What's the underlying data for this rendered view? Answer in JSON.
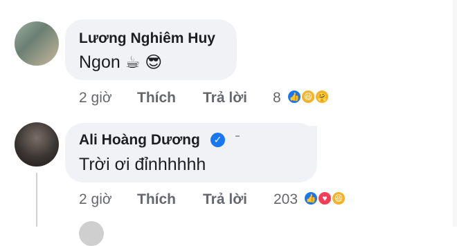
{
  "comments": [
    {
      "author": "Lương Nghiêm Huy",
      "text": "Ngon",
      "time": "2 giờ",
      "like_label": "Thích",
      "reply_label": "Trả lời",
      "reaction_count": "8",
      "reactions": [
        "like",
        "haha",
        "care"
      ],
      "verified": false
    },
    {
      "author": "Ali Hoàng Dương",
      "text": "Trời ơi đỉnhhhhh",
      "time": "2 giờ",
      "like_label": "Thích",
      "reply_label": "Trả lời",
      "reaction_count": "203",
      "reactions": [
        "like",
        "love",
        "haha"
      ],
      "verified": true
    }
  ],
  "icons": {
    "cup": "☕",
    "sunglasses": "😎"
  },
  "colors": {
    "bubble": "#f0f2f5",
    "like": "#1877f2",
    "love": "#f33e58",
    "haha": "#f7b125"
  }
}
